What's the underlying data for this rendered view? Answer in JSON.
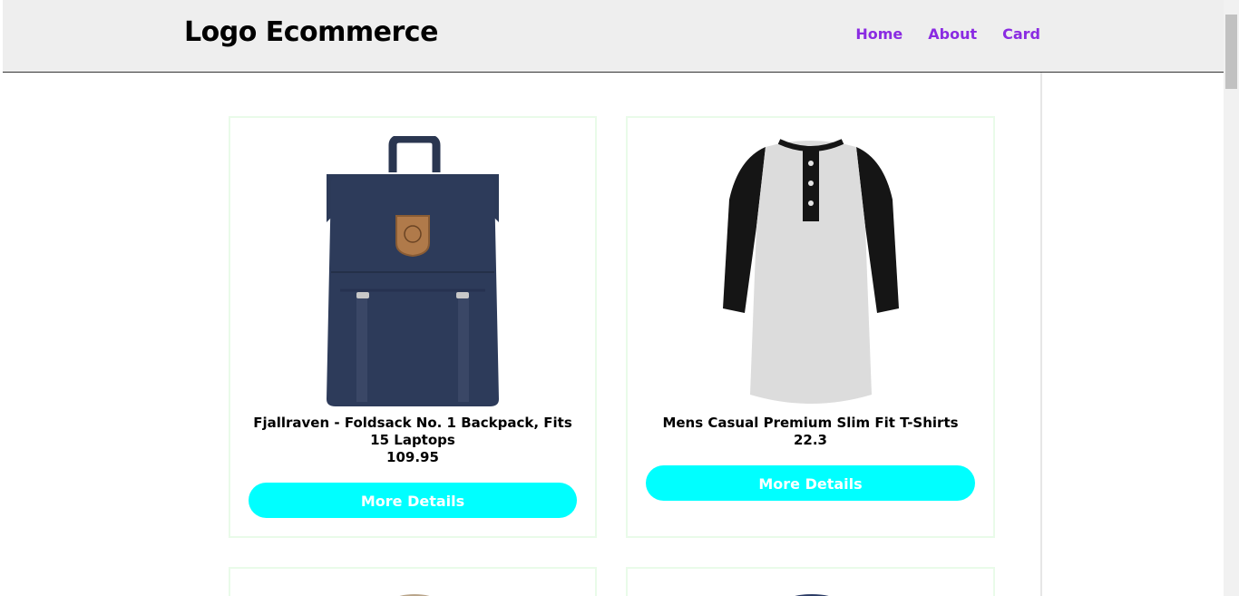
{
  "header": {
    "logo": "Logo Ecommerce",
    "nav": [
      {
        "label": "Home"
      },
      {
        "label": "About"
      },
      {
        "label": "Card"
      }
    ]
  },
  "products": [
    {
      "title": "Fjallraven - Foldsack No. 1 Backpack, Fits 15 Laptops",
      "price": "109.95",
      "button": "More Details",
      "image": "backpack-image"
    },
    {
      "title": "Mens Casual Premium Slim Fit T-Shirts",
      "price": "22.3",
      "button": "More Details",
      "image": "tshirt-image"
    }
  ],
  "colors": {
    "accent_button": "#00ffff",
    "nav_link": "#8a2be2",
    "header_bg": "#eeeeee"
  }
}
